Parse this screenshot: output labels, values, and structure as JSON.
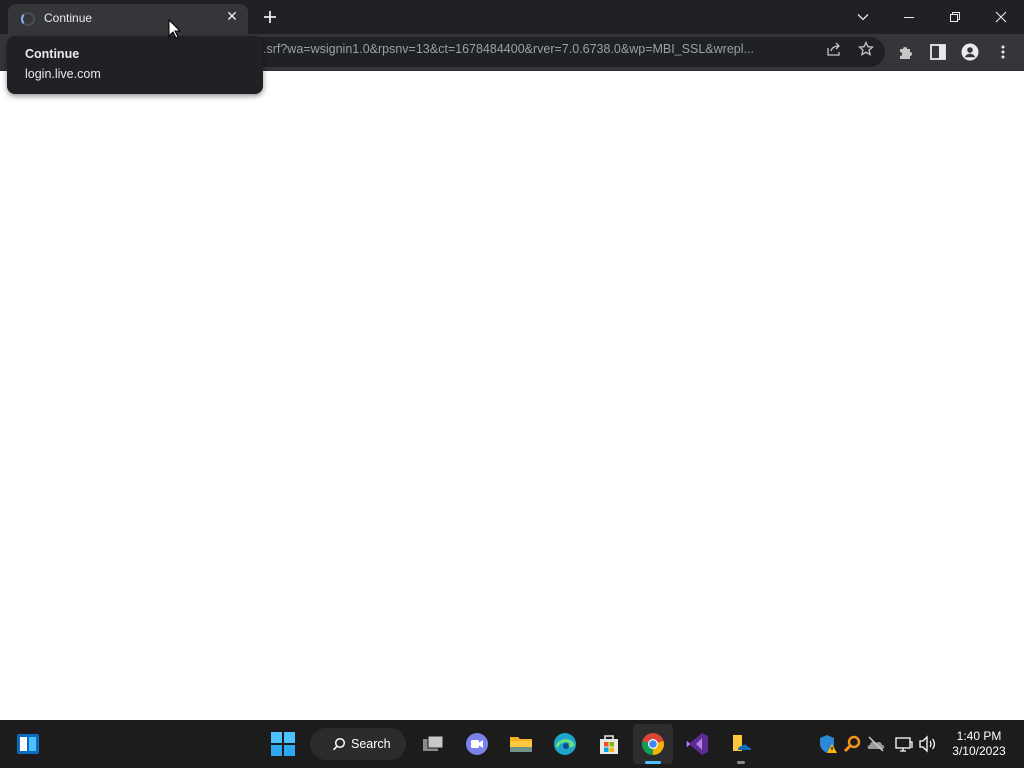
{
  "browser": {
    "tab": {
      "title": "Continue"
    },
    "hovercard": {
      "title": "Continue",
      "domain": "login.live.com"
    },
    "address_bar": {
      "url": ".srf?wa=wsignin1.0&rpsnv=13&ct=1678484400&rver=7.0.6738.0&wp=MBI_SSL&wrepl..."
    },
    "icons": [
      "loading-spinner-icon",
      "close-icon",
      "plus-icon",
      "chevron-down-icon",
      "minimize-icon",
      "restore-icon",
      "close-window-icon",
      "share-icon",
      "star-icon",
      "puzzle-icon",
      "side-panel-icon",
      "profile-icon",
      "more-vert-icon"
    ]
  },
  "taskbar": {
    "search_label": "Search",
    "apps": [
      "widgets",
      "start",
      "search",
      "task-view",
      "teams-chat",
      "file-explorer",
      "edge",
      "microsoft-store",
      "chrome",
      "visual-studio",
      "file-explorer-2"
    ],
    "active_app": "chrome",
    "tray": [
      "windows-security-warning-icon",
      "search-tool-icon",
      "onedrive-offline-icon",
      "network-icon",
      "volume-icon"
    ],
    "time": "1:40 PM",
    "date": "3/10/2023"
  },
  "colors": {
    "titlebar": "#202124",
    "toolbar": "#35363a",
    "omnibox": "#202124",
    "taskbar": "#1c1c1c",
    "accent": "#4cc2ff",
    "page": "#ffffff"
  }
}
